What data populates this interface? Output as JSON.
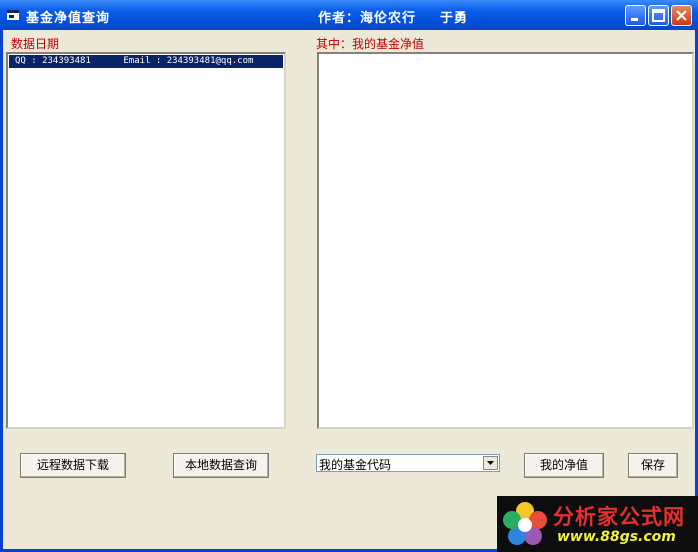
{
  "window": {
    "title": "基金净值查询",
    "author_text": "作者：海伦农行",
    "author_name": "于勇"
  },
  "left_panel": {
    "label": "数据日期",
    "selected_item": "QQ : 234393481      Email : 234393481@qq.com"
  },
  "right_panel": {
    "label": "其中：我的基金净值"
  },
  "buttons": {
    "remote_download": "远程数据下载",
    "local_query": "本地数据查询",
    "my_nav": "我的净值",
    "save": "保存"
  },
  "combo": {
    "value": "我的基金代码"
  },
  "watermark": {
    "name": "分析家公式网",
    "url": "www.88gs.com"
  }
}
